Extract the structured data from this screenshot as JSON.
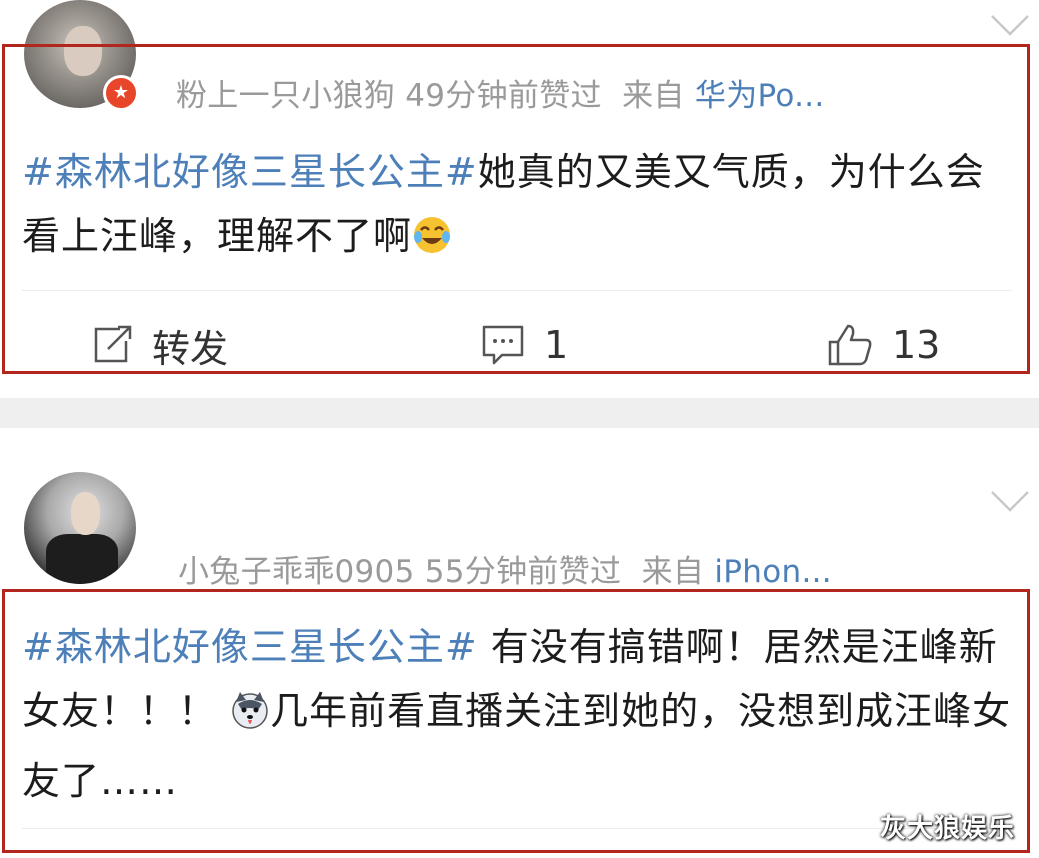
{
  "posts": [
    {
      "username": "粉上一只小狼狗",
      "time": "49分钟前赞过",
      "from_label": "来自",
      "source": "华为Po...",
      "hashtag": "#森林北好像三星长公主#",
      "content": "她真的又美又气质，为什么会看上汪峰，理解不了啊",
      "emoji": "laugh-cry-emoji",
      "actions": {
        "repost_label": "转发",
        "comments": "1",
        "likes": "13"
      }
    },
    {
      "username": "小兔子乖乖0905",
      "time": "55分钟前赞过",
      "from_label": "来自",
      "source": "iPhon...",
      "hashtag": "#森林北好像三星长公主#",
      "content_before_emoji": " 有没有搞错啊！居然是汪峰新女友！！！ ",
      "emoji": "husky-emoji",
      "content_after_emoji": "几年前看直播关注到她的，没想到成汪峰女友了……"
    }
  ],
  "watermark": "灰大狼娱乐",
  "colors": {
    "link": "#4d7fb8",
    "highlight_box": "#b3261e",
    "meta": "#9a9a9a",
    "separator": "#efefef"
  }
}
